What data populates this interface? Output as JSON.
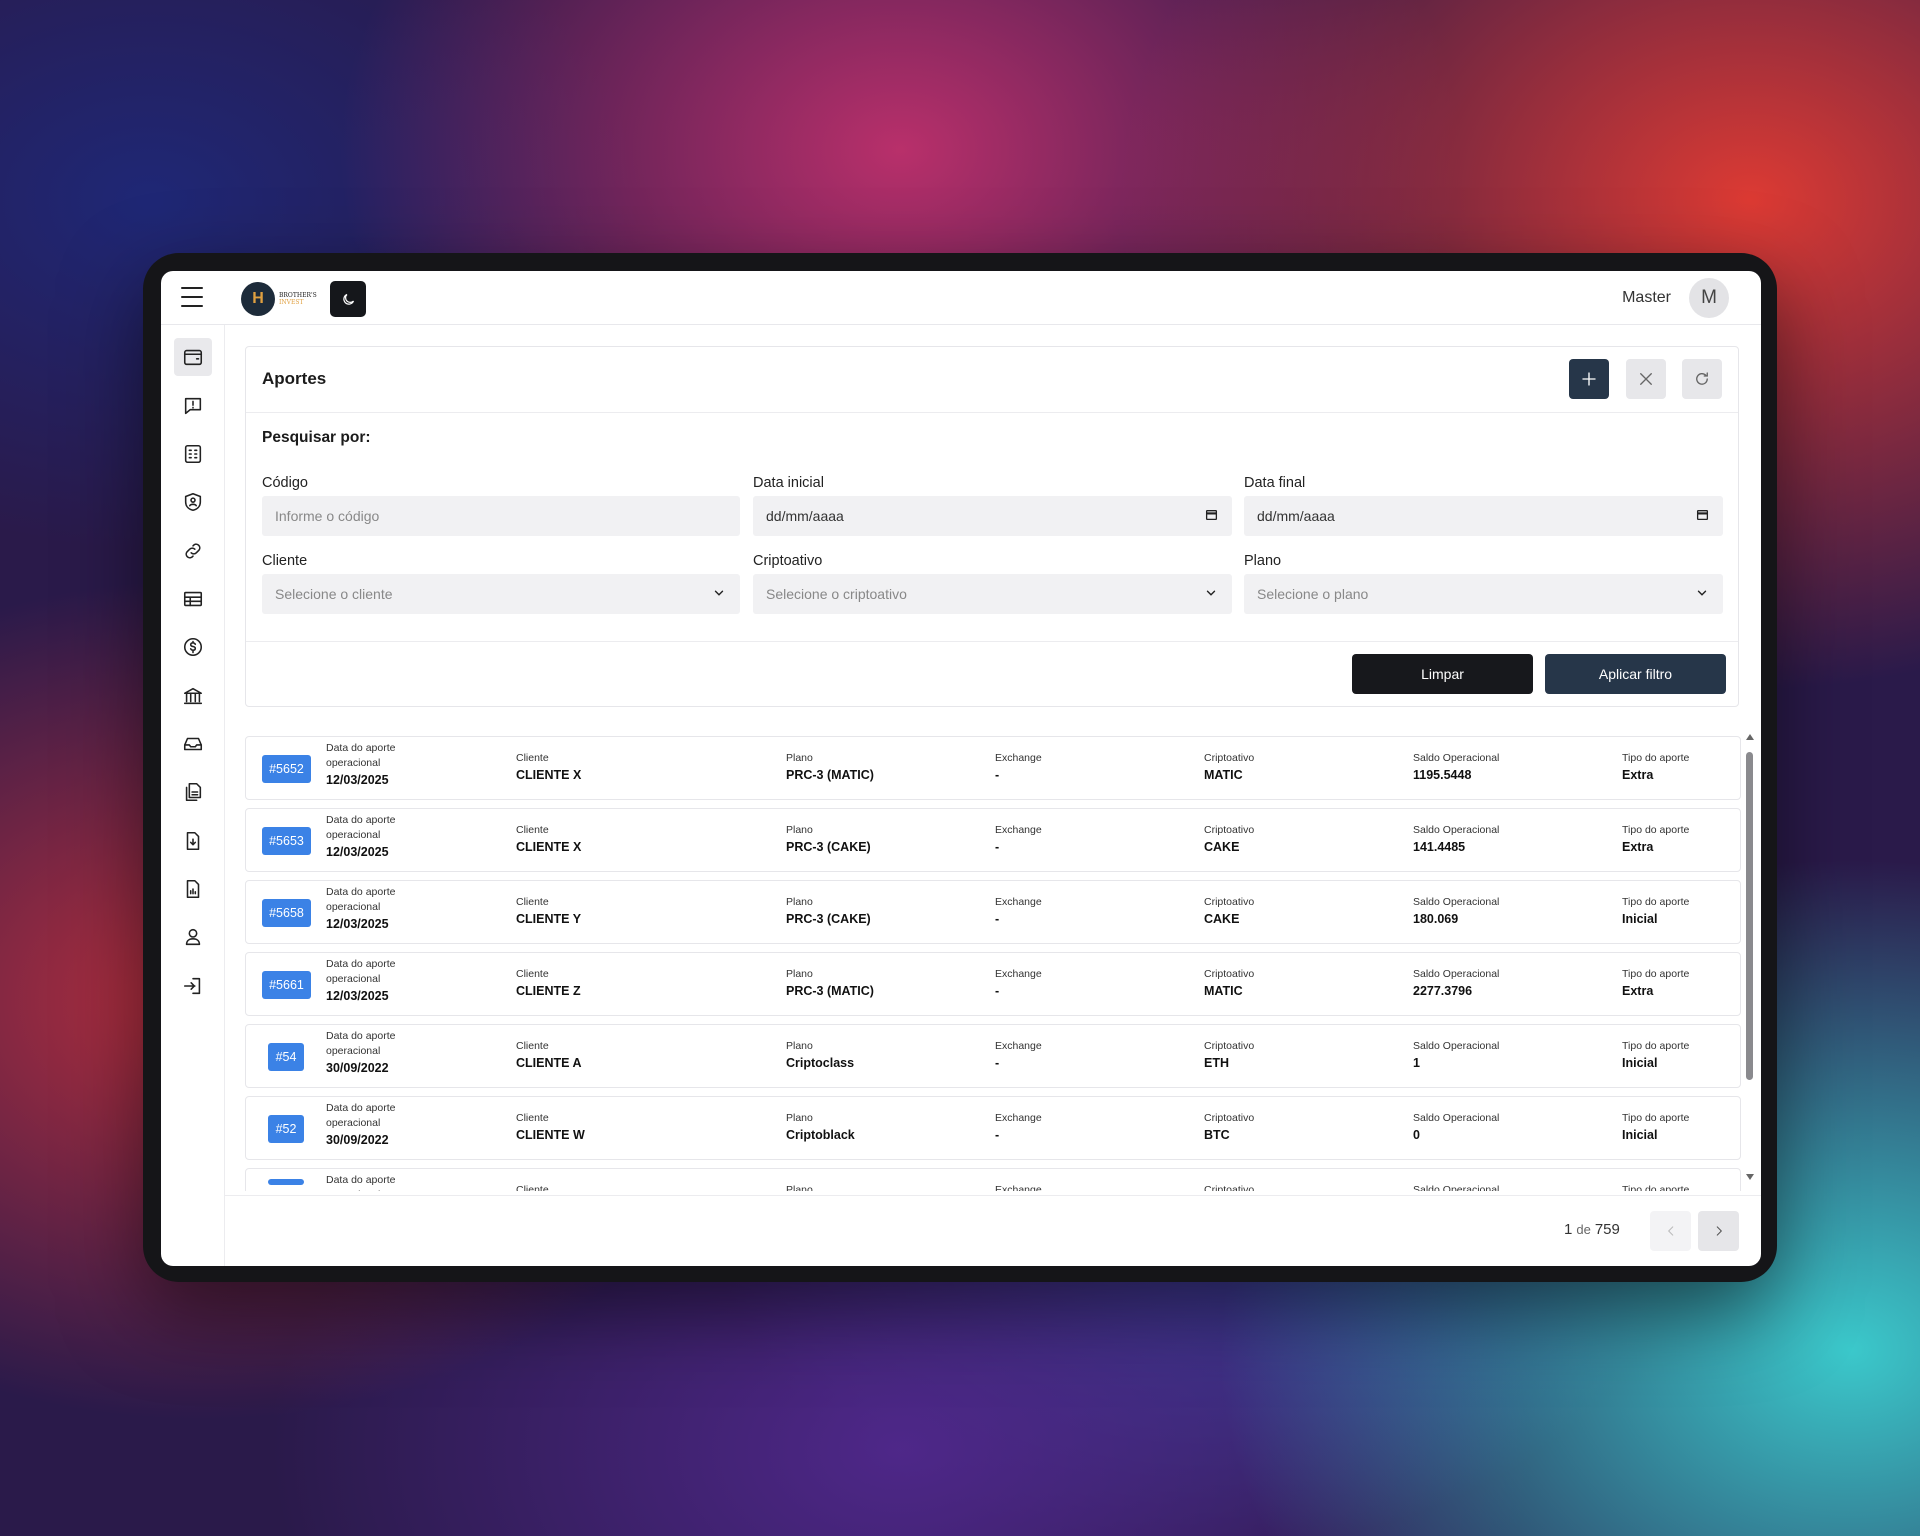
{
  "topbar": {
    "brand": "BROTHER'S",
    "brand_sub": "INVEST",
    "user_name": "Master",
    "avatar_letter": "M"
  },
  "sidebar": {
    "icons": [
      "wallet-icon",
      "alert-message-icon",
      "calculator-icon",
      "user-shield-icon",
      "link-icon",
      "table-icon",
      "dollar-coin-icon",
      "bank-icon",
      "inbox-icon",
      "documents-icon",
      "download-file-icon",
      "report-file-icon",
      "user-icon",
      "logout-icon"
    ]
  },
  "page": {
    "title": "Aportes",
    "search_title": "Pesquisar por:"
  },
  "filters": {
    "codigo_label": "Código",
    "codigo_placeholder": "Informe o código",
    "data_inicial_label": "Data inicial",
    "data_inicial_value": "dd/mm/aaaa",
    "data_final_label": "Data final",
    "data_final_value": "dd/mm/aaaa",
    "cliente_label": "Cliente",
    "cliente_placeholder": "Selecione o cliente",
    "cripto_label": "Criptoativo",
    "cripto_placeholder": "Selecione o criptoativo",
    "plano_label": "Plano",
    "plano_placeholder": "Selecione o plano",
    "limpar": "Limpar",
    "aplicar": "Aplicar filtro"
  },
  "columns": {
    "data": "Data do aporte operacional",
    "cliente": "Cliente",
    "plano": "Plano",
    "exchange": "Exchange",
    "cripto": "Criptoativo",
    "saldo": "Saldo Operacional",
    "tipo": "Tipo do aporte"
  },
  "rows": [
    {
      "code": "#5652",
      "date": "12/03/2025",
      "cliente": "CLIENTE X",
      "plano": "PRC-3 (MATIC)",
      "exchange": "-",
      "cripto": "MATIC",
      "saldo": "1195.5448",
      "tipo": "Extra"
    },
    {
      "code": "#5653",
      "date": "12/03/2025",
      "cliente": "CLIENTE X",
      "plano": "PRC-3 (CAKE)",
      "exchange": "-",
      "cripto": "CAKE",
      "saldo": "141.4485",
      "tipo": "Extra"
    },
    {
      "code": "#5658",
      "date": "12/03/2025",
      "cliente": "CLIENTE Y",
      "plano": "PRC-3 (CAKE)",
      "exchange": "-",
      "cripto": "CAKE",
      "saldo": "180.069",
      "tipo": "Inicial"
    },
    {
      "code": "#5661",
      "date": "12/03/2025",
      "cliente": "CLIENTE Z",
      "plano": "PRC-3 (MATIC)",
      "exchange": "-",
      "cripto": "MATIC",
      "saldo": "2277.3796",
      "tipo": "Extra"
    },
    {
      "code": "#54",
      "date": "30/09/2022",
      "cliente": "CLIENTE A",
      "plano": "Criptoclass",
      "exchange": "-",
      "cripto": "ETH",
      "saldo": "1",
      "tipo": "Inicial"
    },
    {
      "code": "#52",
      "date": "30/09/2022",
      "cliente": "CLIENTE W",
      "plano": "Criptoblack",
      "exchange": "-",
      "cripto": "BTC",
      "saldo": "0",
      "tipo": "Inicial"
    },
    {
      "code": "",
      "date": "",
      "cliente": "",
      "plano": "",
      "exchange": "",
      "cripto": "",
      "saldo": "",
      "tipo": ""
    }
  ],
  "pagination": {
    "current": "1",
    "de": "de",
    "total": "759"
  },
  "colors": {
    "badge": "#3b82e6",
    "primary_dark": "#263649",
    "black_button": "#17181c"
  }
}
